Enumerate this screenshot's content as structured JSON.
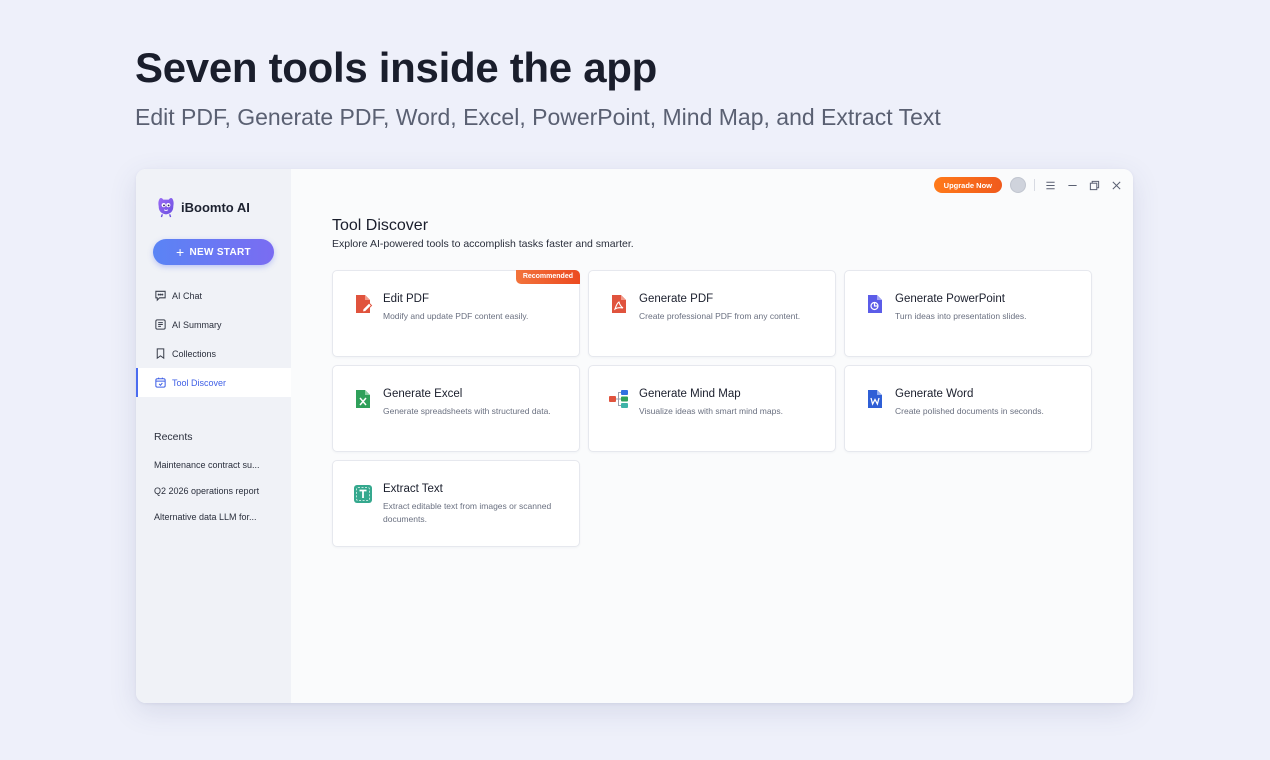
{
  "hero": {
    "title": "Seven tools inside the app",
    "subtitle": "Edit PDF, Generate PDF, Word, Excel, PowerPoint, Mind Map, and Extract Text"
  },
  "app": {
    "brand": "iBoomto AI",
    "new_start_label": "NEW START",
    "upgrade_label": "Upgrade Now",
    "accent_color": "#4b6cf0",
    "upgrade_color": "#f26a1b"
  },
  "sidebar": {
    "items": [
      {
        "label": "AI Chat",
        "icon": "chat-icon",
        "active": false
      },
      {
        "label": "AI Summary",
        "icon": "summary-icon",
        "active": false
      },
      {
        "label": "Collections",
        "icon": "bookmark-icon",
        "active": false
      },
      {
        "label": "Tool Discover",
        "icon": "tool-discover-icon",
        "active": true
      }
    ],
    "recents_title": "Recents",
    "recents": [
      "Maintenance contract su...",
      "Q2 2026 operations report",
      "Alternative data LLM for..."
    ]
  },
  "main": {
    "title": "Tool Discover",
    "subtitle": "Explore AI-powered tools to accomplish tasks faster and smarter.",
    "tools": [
      {
        "title": "Edit PDF",
        "desc": "Modify and update PDF content easily.",
        "icon": "edit-pdf-icon",
        "badge": "Recommended"
      },
      {
        "title": "Generate PDF",
        "desc": "Create professional PDF from any content.",
        "icon": "generate-pdf-icon"
      },
      {
        "title": "Generate PowerPoint",
        "desc": "Turn ideas into presentation slides.",
        "icon": "powerpoint-icon"
      },
      {
        "title": "Generate Excel",
        "desc": "Generate spreadsheets with structured data.",
        "icon": "excel-icon"
      },
      {
        "title": "Generate Mind Map",
        "desc": "Visualize ideas with smart mind maps.",
        "icon": "mind-map-icon"
      },
      {
        "title": "Generate Word",
        "desc": "Create polished documents in seconds.",
        "icon": "word-icon"
      },
      {
        "title": "Extract Text",
        "desc": "Extract editable text from images or scanned documents.",
        "icon": "extract-text-icon"
      }
    ]
  }
}
